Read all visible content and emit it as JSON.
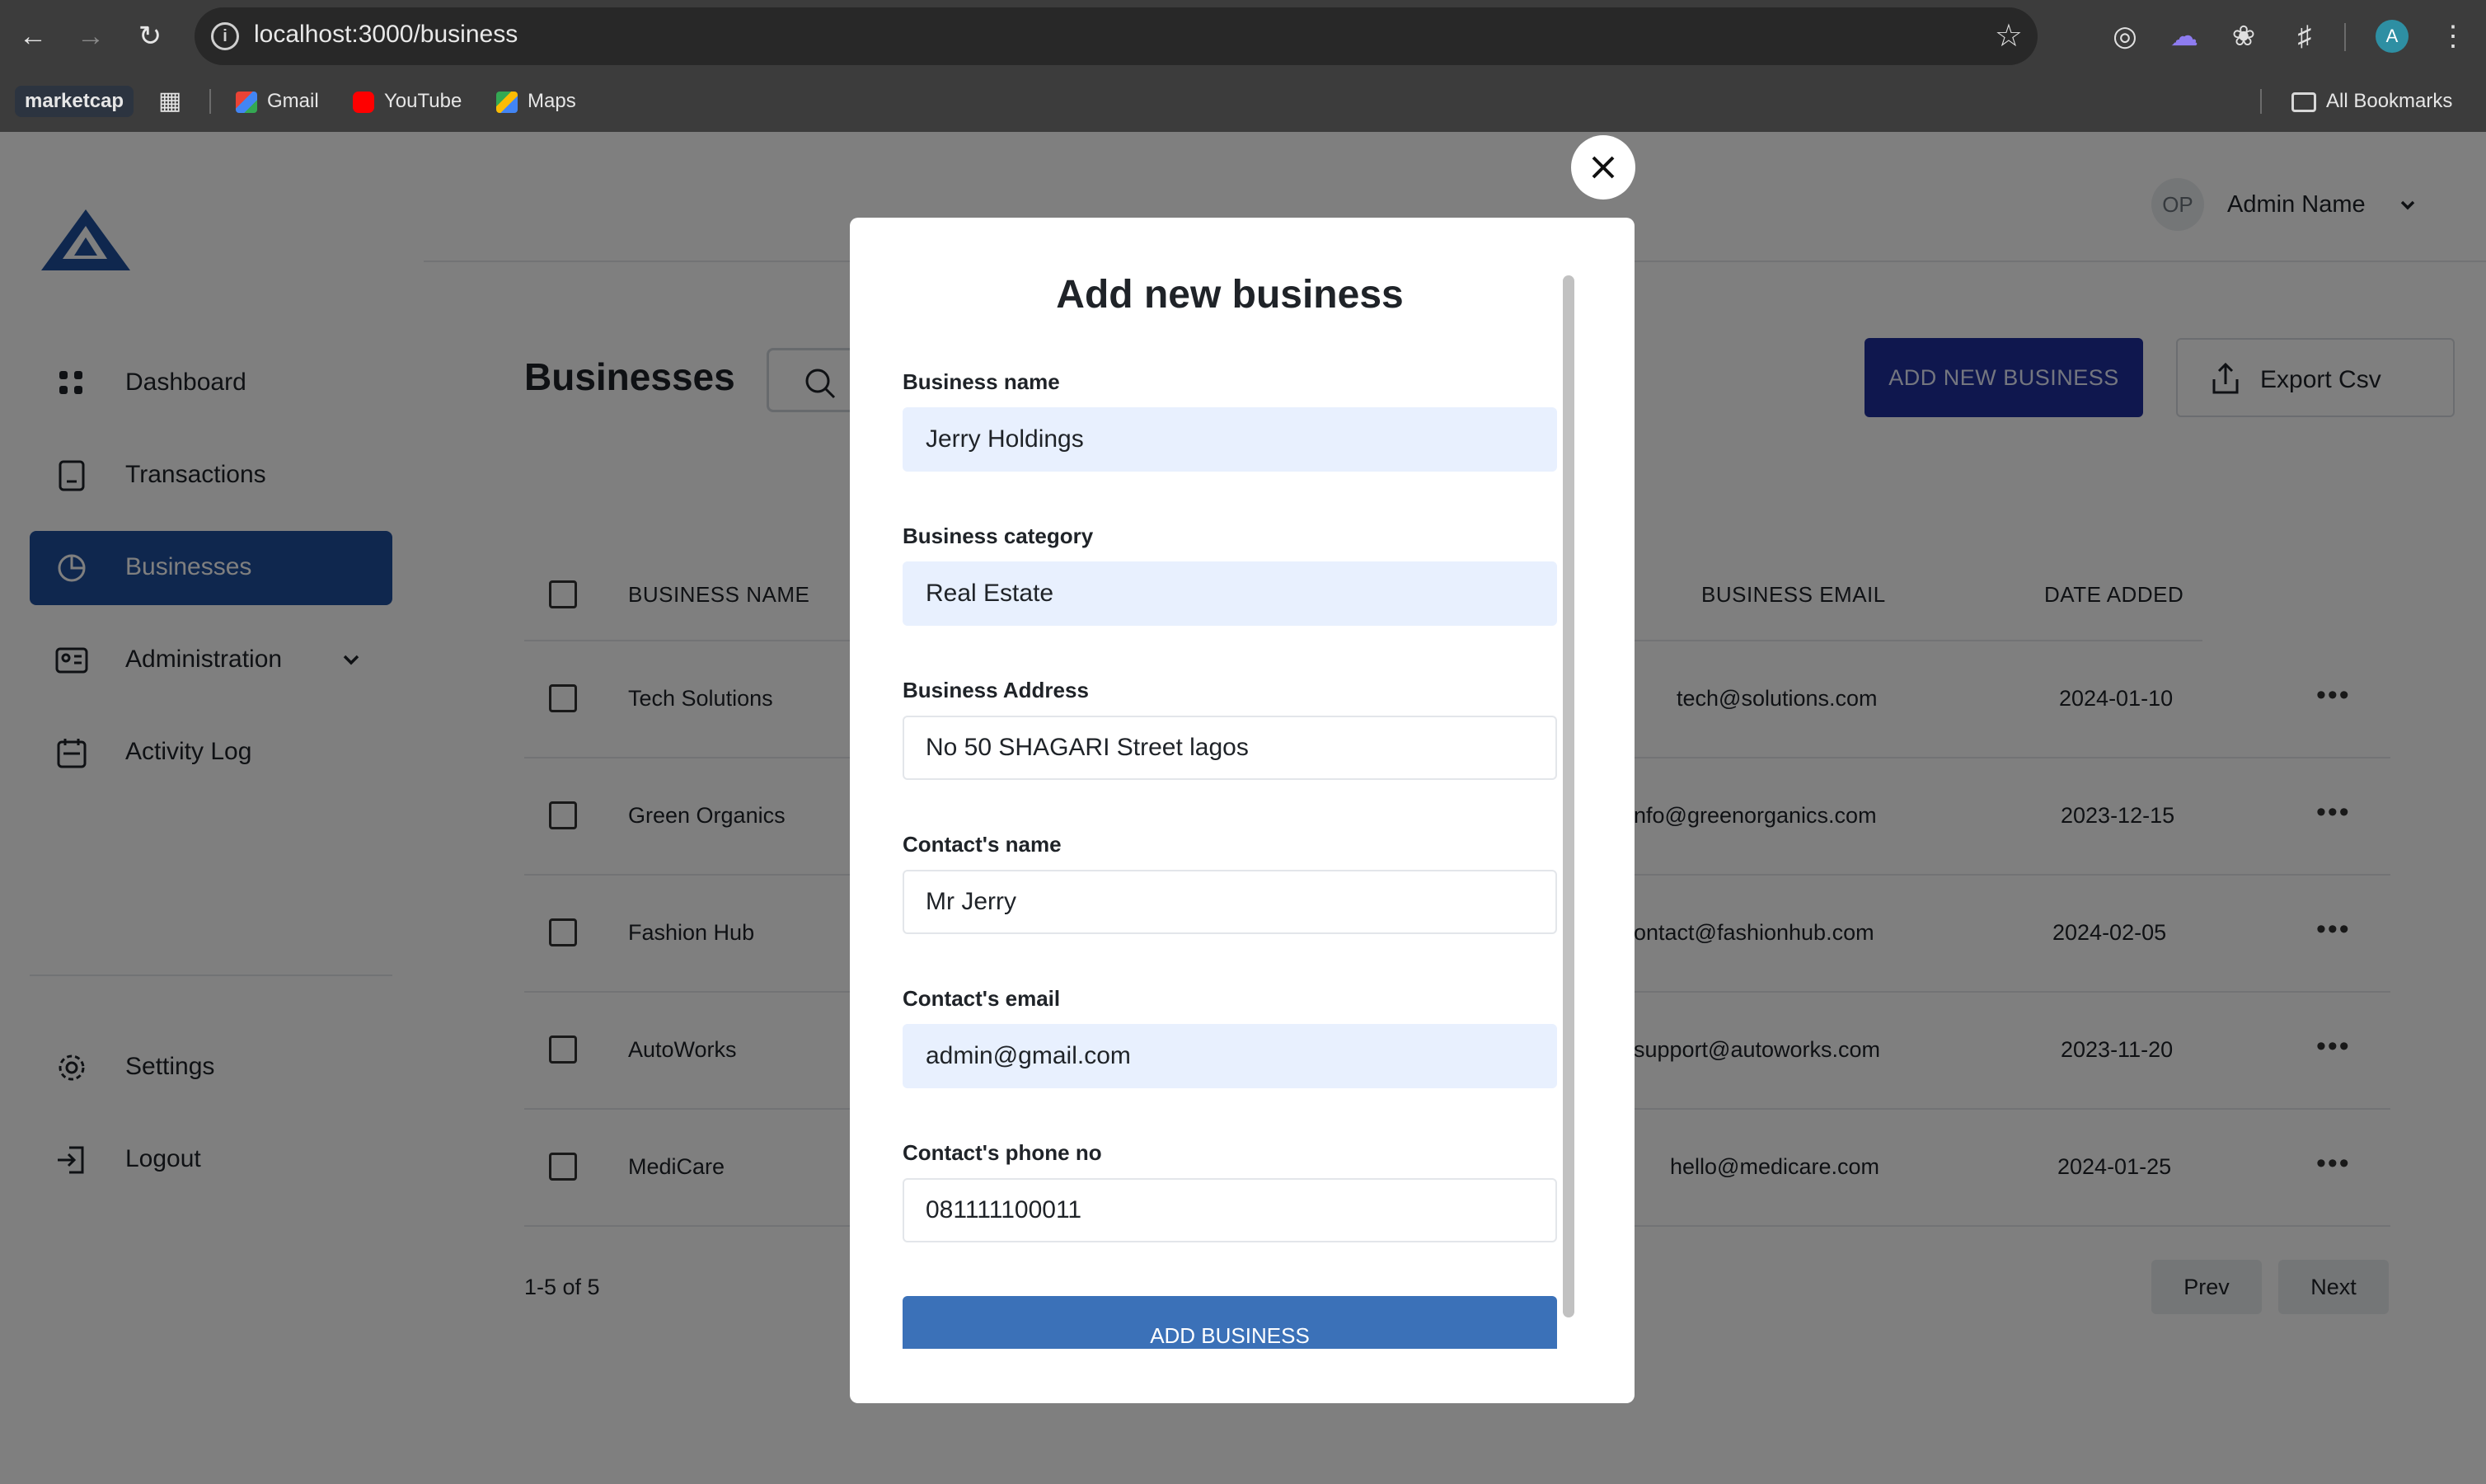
{
  "browser": {
    "url": "localhost:3000/business",
    "bookmarks": [
      "marketcap",
      "Gmail",
      "YouTube",
      "Maps"
    ],
    "all_bookmarks": "All Bookmarks",
    "profile_initial": "A"
  },
  "header": {
    "user_initials": "OP",
    "user_name": "Admin Name"
  },
  "sidebar": {
    "items": [
      {
        "label": "Dashboard"
      },
      {
        "label": "Transactions"
      },
      {
        "label": "Businesses"
      },
      {
        "label": "Administration"
      },
      {
        "label": "Activity Log"
      }
    ],
    "bottom_items": [
      {
        "label": "Settings"
      },
      {
        "label": "Logout"
      }
    ]
  },
  "main": {
    "title": "Businesses",
    "add_button": "ADD NEW BUSINESS",
    "export_button": "Export Csv",
    "table": {
      "headers": [
        "BUSINESS NAME",
        "BUSINESS EMAIL",
        "DATE ADDED"
      ],
      "rows": [
        {
          "name": "Tech Solutions",
          "email": "tech@solutions.com",
          "date": "2024-01-10"
        },
        {
          "name": "Green Organics",
          "email": "nfo@greenorganics.com",
          "date": "2023-12-15"
        },
        {
          "name": "Fashion Hub",
          "email": "ontact@fashionhub.com",
          "date": "2024-02-05"
        },
        {
          "name": "AutoWorks",
          "email": "support@autoworks.com",
          "date": "2023-11-20"
        },
        {
          "name": "MediCare",
          "email": "hello@medicare.com",
          "date": "2024-01-25"
        }
      ]
    },
    "pagination": {
      "count": "1-5 of 5",
      "prev": "Prev",
      "next": "Next"
    }
  },
  "modal": {
    "title": "Add new business",
    "fields": [
      {
        "label": "Business name",
        "value": "Jerry Holdings"
      },
      {
        "label": "Business category",
        "value": "Real Estate"
      },
      {
        "label": "Business Address",
        "value": "No 50 SHAGARI Street lagos"
      },
      {
        "label": "Contact's name",
        "value": "Mr Jerry"
      },
      {
        "label": "Contact's email",
        "value": "admin@gmail.com"
      },
      {
        "label": "Contact's phone no",
        "value": "081111100011"
      }
    ],
    "submit": "ADD BUSINESS"
  }
}
